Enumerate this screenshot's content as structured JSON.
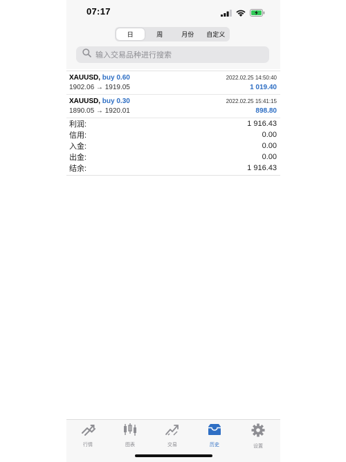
{
  "status_bar": {
    "time": "07:17"
  },
  "tabs": [
    {
      "label": "日",
      "active": true
    },
    {
      "label": "周",
      "active": false
    },
    {
      "label": "月份",
      "active": false
    },
    {
      "label": "自定义",
      "active": false
    }
  ],
  "search": {
    "placeholder": "输入交易品种进行搜索"
  },
  "deals": [
    {
      "symbol": "XAUUSD,",
      "side": "buy 0.60",
      "prices": "1902.06 → 1919.05",
      "datetime": "2022.02.25 14:50:40",
      "profit": "1 019.40"
    },
    {
      "symbol": "XAUUSD,",
      "side": "buy 0.30",
      "prices": "1890.05 → 1920.01",
      "datetime": "2022.02.25 15:41:15",
      "profit": "898.80"
    }
  ],
  "summary": [
    {
      "label": "利润:",
      "value": "1 916.43"
    },
    {
      "label": "信用:",
      "value": "0.00"
    },
    {
      "label": "入金:",
      "value": "0.00"
    },
    {
      "label": "出金:",
      "value": "0.00"
    },
    {
      "label": "结余:",
      "value": "1 916.43"
    }
  ],
  "tabbar": [
    {
      "label": "行情",
      "icon": "quotes-icon",
      "active": false
    },
    {
      "label": "图表",
      "icon": "chart-icon",
      "active": false
    },
    {
      "label": "交易",
      "icon": "trade-icon",
      "active": false
    },
    {
      "label": "历史",
      "icon": "history-icon",
      "active": true
    },
    {
      "label": "设置",
      "icon": "settings-icon",
      "active": false
    }
  ],
  "colors": {
    "accent": "#2f6fc4",
    "inactive_icon": "#8e8e93"
  }
}
